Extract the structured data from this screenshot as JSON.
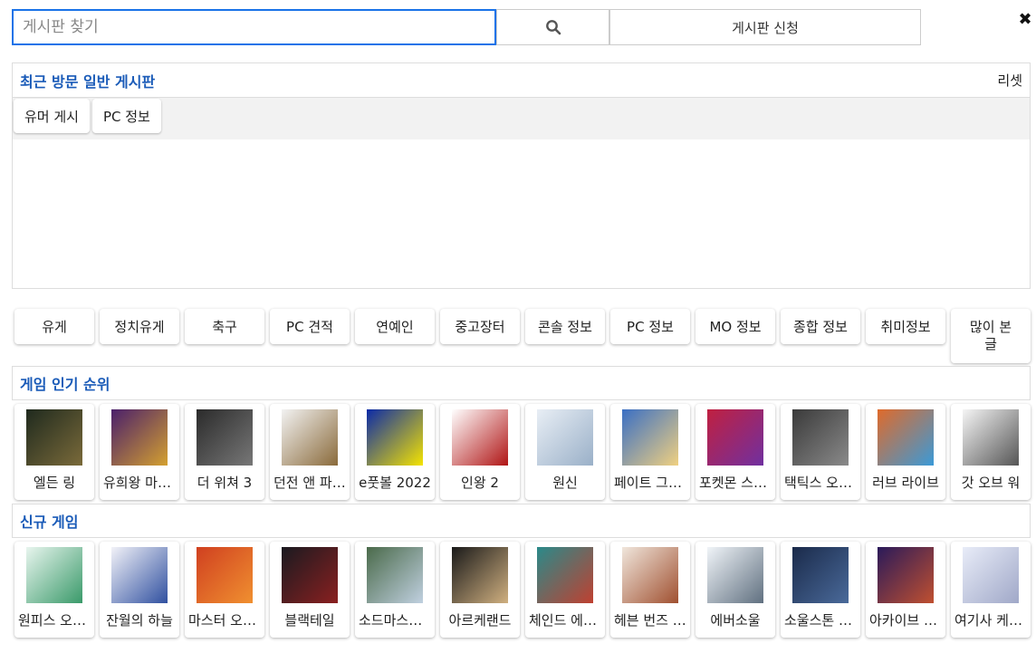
{
  "search": {
    "placeholder": "게시판 찾기",
    "icon": "search-icon"
  },
  "apply_button": "게시판 신청",
  "close_glyph": "✖",
  "recent": {
    "title": "최근 방문 일반 게시판",
    "reset": "리셋",
    "items": [
      "유머 게시",
      "PC 정보"
    ]
  },
  "categories": [
    "유게",
    "정치유게",
    "축구",
    "PC 견적",
    "연예인",
    "중고장터",
    "콘솔 정보",
    "PC 정보",
    "MO 정보",
    "종합 정보",
    "취미정보",
    "많이 본 글"
  ],
  "popular": {
    "title": "게임 인기 순위",
    "games": [
      {
        "name": "엘든 링",
        "colors": [
          "#1f2a1e",
          "#7a6a3a"
        ]
      },
      {
        "name": "유희왕 마스터 듀얼",
        "colors": [
          "#4a1f6b",
          "#d4a030"
        ]
      },
      {
        "name": "더 위쳐 3",
        "colors": [
          "#2b2b2b",
          "#777777"
        ]
      },
      {
        "name": "던전 앤 파이터",
        "colors": [
          "#f2f2f2",
          "#8a6a3a"
        ]
      },
      {
        "name": "e풋볼 2022",
        "colors": [
          "#0b2aa8",
          "#f5e400"
        ]
      },
      {
        "name": "인왕 2",
        "colors": [
          "#ffffff",
          "#b01515"
        ]
      },
      {
        "name": "원신",
        "colors": [
          "#e8eef5",
          "#9ab0c8"
        ]
      },
      {
        "name": "페이트 그랜드 오더",
        "colors": [
          "#3a6fc4",
          "#f0d080"
        ]
      },
      {
        "name": "포켓몬 스칼렛 바이올렛",
        "colors": [
          "#c02040",
          "#7030a0"
        ]
      },
      {
        "name": "택틱스 오우거",
        "colors": [
          "#3a3a3a",
          "#8a8a8a"
        ]
      },
      {
        "name": "러브 라이브",
        "colors": [
          "#e06a2a",
          "#3a9ad8"
        ]
      },
      {
        "name": "갓 오브 워",
        "colors": [
          "#f5f5f5",
          "#555555"
        ]
      }
    ]
  },
  "new_games": {
    "title": "신규 게임",
    "games": [
      {
        "name": "원피스 오디세이",
        "colors": [
          "#e8f5ee",
          "#3a9a6a"
        ]
      },
      {
        "name": "잔월의 하늘",
        "colors": [
          "#f2f2f8",
          "#3050a0"
        ]
      },
      {
        "name": "마스터 오브 나이츠",
        "colors": [
          "#d04020",
          "#f09030"
        ]
      },
      {
        "name": "블랙테일",
        "colors": [
          "#1a1a20",
          "#8a2020"
        ]
      },
      {
        "name": "소드마스터 스토리",
        "colors": [
          "#4a6a4a",
          "#c0d0e0"
        ]
      },
      {
        "name": "아르케랜드",
        "colors": [
          "#1a1a1a",
          "#d0b080"
        ]
      },
      {
        "name": "체인드 에코스",
        "colors": [
          "#2a8a8a",
          "#c04030"
        ]
      },
      {
        "name": "헤븐 번즈 레드",
        "colors": [
          "#f0e6dc",
          "#a05030"
        ]
      },
      {
        "name": "에버소울",
        "colors": [
          "#f0f4f8",
          "#607080"
        ]
      },
      {
        "name": "소울스톤 서바이버",
        "colors": [
          "#1a2a4a",
          "#4a6a9a"
        ]
      },
      {
        "name": "아카이브 오브 페이트",
        "colors": [
          "#2a1a5a",
          "#c05030"
        ]
      },
      {
        "name": "여기사 케이티",
        "colors": [
          "#e8ecf8",
          "#a0a8c8"
        ]
      }
    ]
  }
}
